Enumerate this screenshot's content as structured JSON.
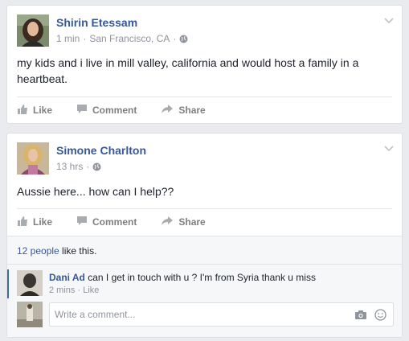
{
  "posts": [
    {
      "author": "Shirin Etessam",
      "time": "1 min",
      "location": "San Francisco, CA",
      "separator": "·",
      "text": "my kids and i live in mill valley, california and would host a family in a heartbeat.",
      "actions": {
        "like": "Like",
        "comment": "Comment",
        "share": "Share"
      }
    },
    {
      "author": "Simone Charlton",
      "time": "13 hrs",
      "separator": "·",
      "text": "Aussie here... how can I help??",
      "actions": {
        "like": "Like",
        "comment": "Comment",
        "share": "Share"
      },
      "likes": {
        "count_link": "12 people",
        "suffix": " like this."
      },
      "comment": {
        "author": "Dani Ad",
        "text": " can I get in touch with u ? I'm from Syria thank u miss",
        "time": "2 mins",
        "separator": "·",
        "like": "Like"
      },
      "composer": {
        "placeholder": "Write a comment..."
      }
    }
  ],
  "icons": {
    "globe": "globe-icon",
    "chevron": "chevron-down-icon",
    "like": "thumbs-up-icon",
    "comment": "comment-bubble-icon",
    "share": "share-arrow-icon",
    "camera": "camera-icon",
    "emoji": "smiley-icon"
  },
  "colors": {
    "link": "#365899",
    "meta": "#90949c",
    "action": "#7f7f7f",
    "accent_bar": "#4267b2",
    "background": "#e9ebee"
  }
}
